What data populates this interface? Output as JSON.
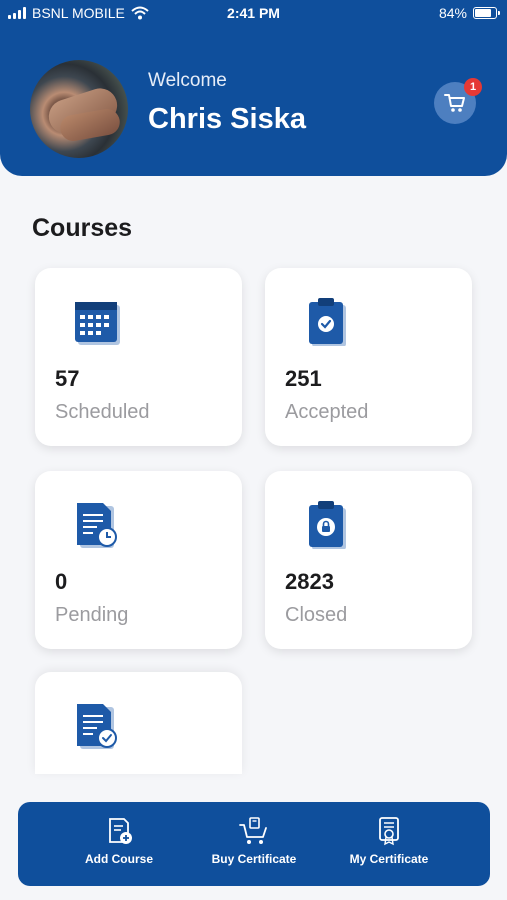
{
  "status_bar": {
    "carrier": "BSNL MOBILE",
    "time": "2:41 PM",
    "battery": "84%"
  },
  "header": {
    "welcome": "Welcome",
    "user_name": "Chris Siska",
    "cart_count": "1"
  },
  "courses": {
    "title": "Courses",
    "cards": [
      {
        "count": "57",
        "label": "Scheduled",
        "icon": "calendar-icon"
      },
      {
        "count": "251",
        "label": "Accepted",
        "icon": "clipboard-check-icon"
      },
      {
        "count": "0",
        "label": "Pending",
        "icon": "document-clock-icon"
      },
      {
        "count": "2823",
        "label": "Closed",
        "icon": "clipboard-lock-icon"
      },
      {
        "icon": "document-check-icon"
      }
    ]
  },
  "bottom_nav": {
    "items": [
      {
        "label": "Add Course",
        "icon": "add-course-icon"
      },
      {
        "label": "Buy Certificate",
        "icon": "cart-certificate-icon"
      },
      {
        "label": "My Certificate",
        "icon": "certificate-icon"
      }
    ]
  },
  "colors": {
    "primary": "#0f4f9c",
    "badge": "#e53935",
    "background": "#f5f6f9"
  }
}
